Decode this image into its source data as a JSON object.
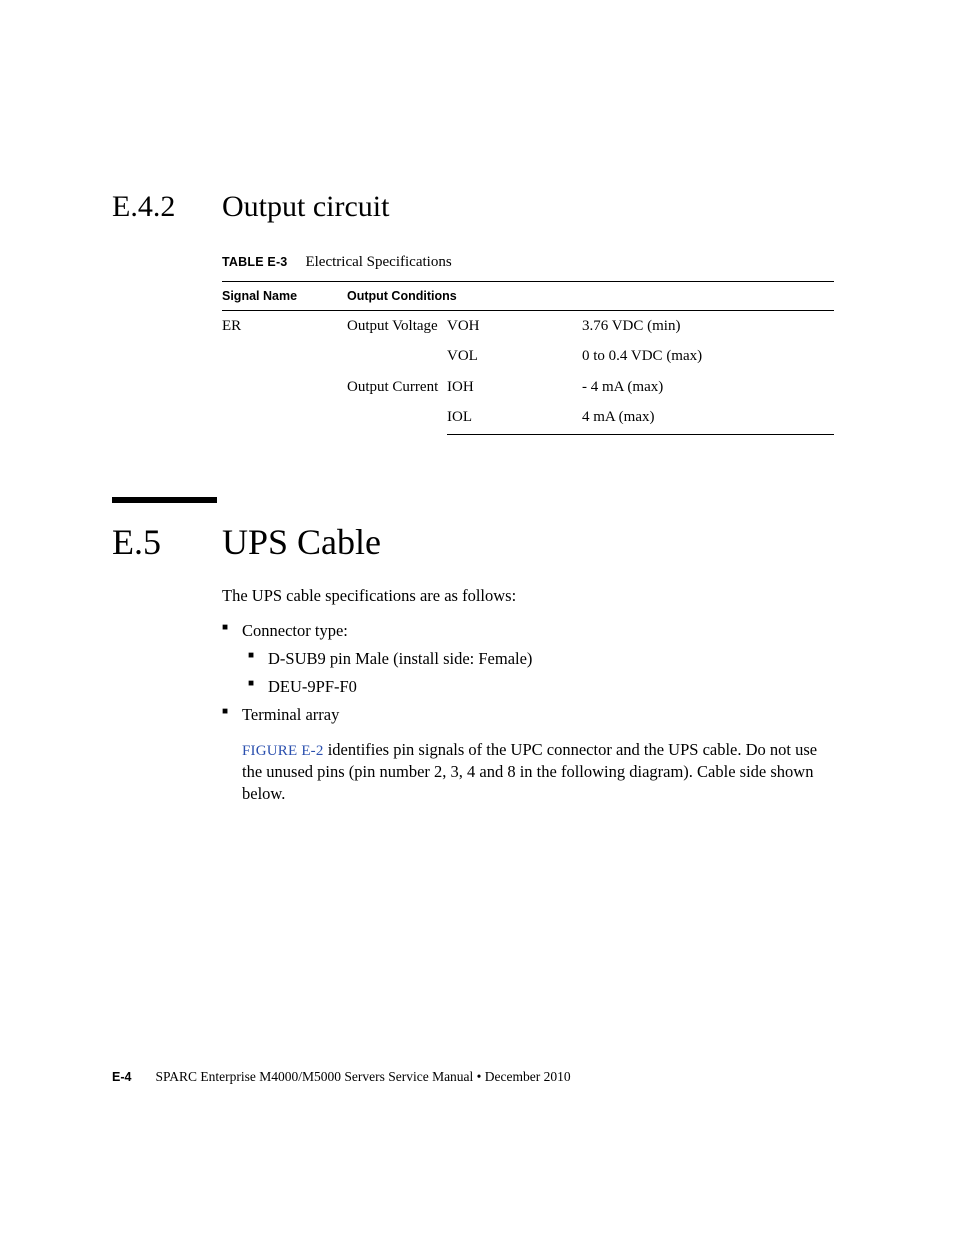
{
  "section1": {
    "number": "E.4.2",
    "title": "Output circuit",
    "table": {
      "caption_label": "TABLE E-3",
      "caption_text": "Electrical Specifications",
      "headers": {
        "signal": "Signal Name",
        "cond": "Output Conditions"
      },
      "signal": "ER",
      "cond_voltage": "Output Voltage",
      "cond_current": "Output Current",
      "rows": {
        "voh": {
          "sym": "VOH",
          "val": "3.76 VDC (min)"
        },
        "vol": {
          "sym": "VOL",
          "val": "0 to 0.4 VDC (max)"
        },
        "ioh": {
          "sym": "IOH",
          "val": "- 4 mA (max)"
        },
        "iol": {
          "sym": "IOL",
          "val": "4 mA (max)"
        }
      }
    }
  },
  "section2": {
    "number": "E.5",
    "title": "UPS Cable",
    "intro": "The UPS cable specifications are as follows:",
    "bullets": {
      "connector": "Connector type:",
      "sub1": "D-SUB9 pin Male (install side: Female)",
      "sub2": "DEU-9PF-F0",
      "terminal": "Terminal array"
    },
    "figref": "FIGURE E-2",
    "figtext": " identifies pin signals of the UPC connector and the UPS cable. Do not use the unused pins (pin number 2, 3, 4 and 8 in the following diagram). Cable side shown below."
  },
  "footer": {
    "page": "E-4",
    "text": "SPARC Enterprise M4000/M5000 Servers Service Manual  •  December 2010"
  }
}
